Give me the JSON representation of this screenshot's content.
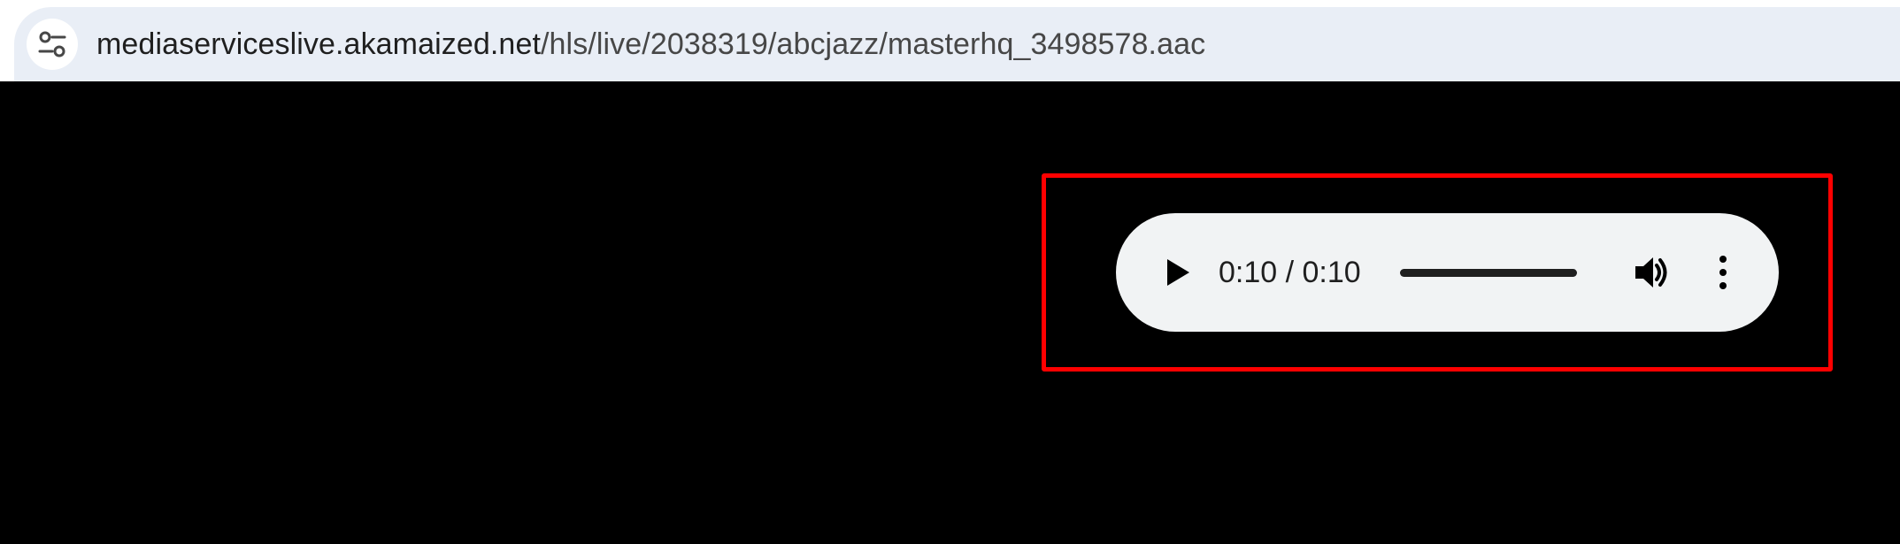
{
  "browser": {
    "address_bar": {
      "host": "mediaserviceslive.akamaized.net",
      "path": "/hls/live/2038319/abcjazz/masterhq_3498578.aac",
      "site_info_icon": "tune-icon"
    }
  },
  "audio_player": {
    "time": "0:10 / 0:10",
    "progress_fraction": 1.0,
    "play_icon": "play-icon",
    "volume_icon": "volume-icon",
    "menu_icon": "more-vert-icon"
  },
  "colors": {
    "page_background": "#000000",
    "address_bar": "#e9eef6",
    "player_background": "#f1f3f4",
    "highlight": "#ff0000"
  }
}
